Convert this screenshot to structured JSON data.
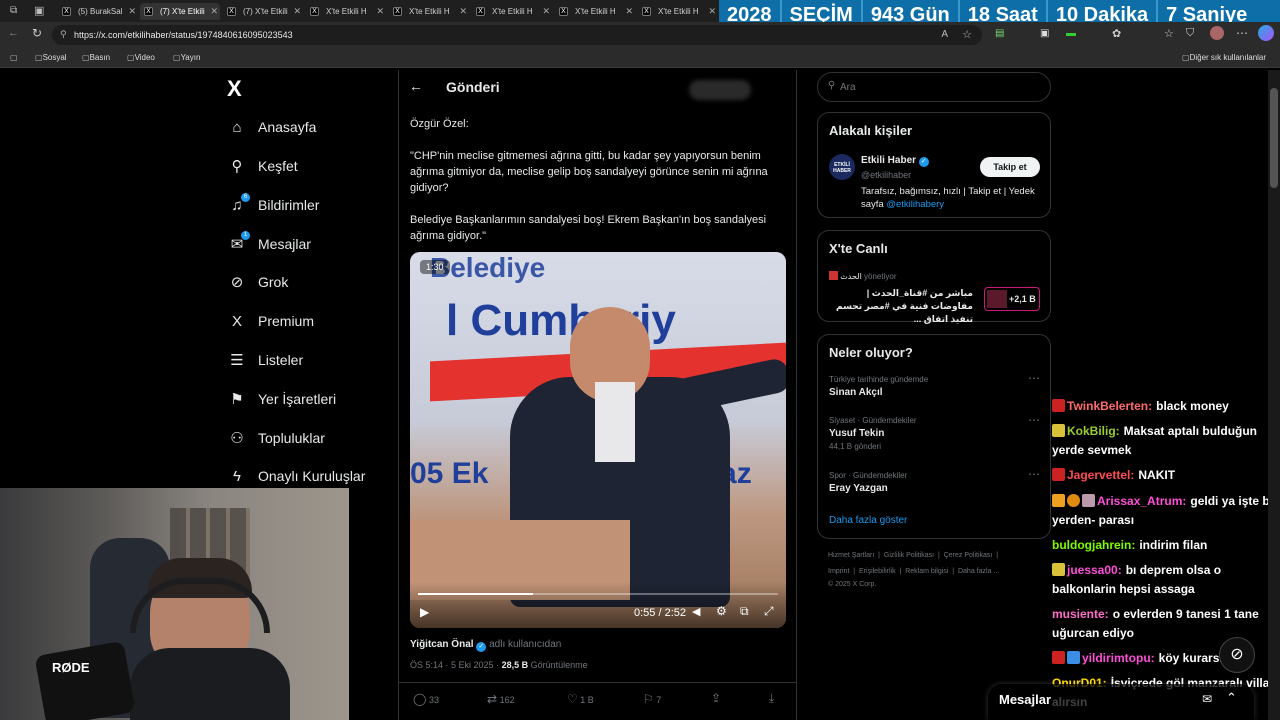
{
  "browser": {
    "tabs": [
      {
        "label": "(5) BurakSal"
      },
      {
        "label": "(7) X'te Etkili"
      },
      {
        "label": "(7) X'te Etkili"
      },
      {
        "label": "X'te Etkili H"
      },
      {
        "label": "X'te Etkili H"
      },
      {
        "label": "X'te Etkili H"
      },
      {
        "label": "X'te Etkili H"
      },
      {
        "label": "X'te Etkili H"
      }
    ],
    "url": "https://x.com/etkilihaber/status/1974840616095023543",
    "bookmarks": [
      "Sosyal",
      "Basın",
      "Video",
      "Yayın"
    ],
    "bookmarks_right": "Diğer sık kullanılanlar"
  },
  "countdown": {
    "year": "2028",
    "label": "SEÇİM",
    "days": "943 Gün",
    "hours": "18 Saat",
    "minutes": "10 Dakika",
    "seconds": "7 Saniye"
  },
  "nav": {
    "logo": "X",
    "items": [
      {
        "label": "Anasayfa",
        "icon": "home-icon"
      },
      {
        "label": "Keşfet",
        "icon": "search-icon"
      },
      {
        "label": "Bildirimler",
        "icon": "bell-icon",
        "badge": "6"
      },
      {
        "label": "Mesajlar",
        "icon": "mail-icon",
        "badge": "1"
      },
      {
        "label": "Grok",
        "icon": "grok-icon"
      },
      {
        "label": "Premium",
        "icon": "x-icon"
      },
      {
        "label": "Listeler",
        "icon": "list-icon"
      },
      {
        "label": "Yer İşaretleri",
        "icon": "bookmark-icon"
      },
      {
        "label": "Topluluklar",
        "icon": "people-icon"
      },
      {
        "label": "Onaylı Kuruluşlar",
        "icon": "lightning-icon"
      }
    ]
  },
  "post": {
    "header": "Gönderi",
    "speaker": "Özgür Özel:",
    "quote1": "\"CHP'nin meclise gitmemesi ağrına gitti, bu kadar şey yapıyorsun benim ağrıma gitmiyor da, meclise gelip boş sandalyeyi görünce senin mi ağrına gidiyor?",
    "quote2": "Belediye Başkanlarımın sandalyesi boş! Ekrem Başkan'ın boş sandalyesi ağrıma gidiyor.\"",
    "video": {
      "duration_badge": "1:30",
      "time": "0:55 / 2:52",
      "progress": 0.32,
      "banner_top": "Belediye",
      "banner_mid": "l Cumhuriy",
      "banner_bottom_left": "05 Ek",
      "banner_bottom_right": "5 Paz"
    },
    "author_name": "Yiğitcan Önal",
    "author_handle": "adlı kullanıcıdan",
    "timestamp": "ÖS 5:14 · 5 Eki 2025",
    "views_count": "28,5 B",
    "views_label": "Görüntülenme",
    "actions": {
      "replies": "33",
      "reposts": "162",
      "likes": "1 B",
      "bookmarks": "7"
    }
  },
  "sidebar": {
    "search_placeholder": "Ara",
    "related_title": "Alakalı kişiler",
    "related_person": {
      "name": "Etkili Haber",
      "handle": "@etkilihaber",
      "follow_label": "Takip et",
      "bio": "Tarafsız, bağımsız, hızlı | Takip et | Yedek sayfa",
      "bio_link": "@etkilihabery",
      "avatar_text": "ETKİLİ HABER"
    },
    "live_title": "X'te Canlı",
    "live": {
      "channel": "الحدث",
      "status": "yönetiyor",
      "text": "مباشر من #قناة_الحدث | مفاوضات فنية في #مصر تحسم تنفيذ اتفاق ...",
      "count": "+2,1 B"
    },
    "trends_title": "Neler oluyor?",
    "trends": [
      {
        "context": "Türkiye tarihinde gündemde",
        "name": "Sinan Akçıl",
        "posts": ""
      },
      {
        "context": "Siyaset · Gündemdekiler",
        "name": "Yusuf Tekin",
        "posts": "44,1 B gönderi"
      },
      {
        "context": "Spor · Gündemdekiler",
        "name": "Eray Yazgan",
        "posts": ""
      }
    ],
    "show_more": "Daha fazla göster",
    "footer_line1": [
      "Hizmet Şartları",
      "Gizlilik Politikası",
      "Çerez Politikası"
    ],
    "footer_line2": [
      "Imprint",
      "Erişilebilirlik",
      "Reklam bilgisi",
      "Daha fazla ..."
    ],
    "copyright": "© 2025 X Corp."
  },
  "chat": [
    {
      "user": "TwinkBelerten:",
      "msg": "black money",
      "color": "#ff6b6b"
    },
    {
      "user": "KokBilig:",
      "msg": "Maksat aptalı bulduğun yerde sevmek",
      "color": "#9acd32"
    },
    {
      "user": "Jagervettel:",
      "msg": "NAKIT",
      "color": "#ff4d4d"
    },
    {
      "user": "Arissax_Atrum:",
      "msg": "geldi ya işte bi yerden- parası",
      "color": "#ff4fd8"
    },
    {
      "user": "buldogjahrein:",
      "msg": "indirim filan",
      "color": "#7cfc00"
    },
    {
      "user": "juessa00:",
      "msg": "bı deprem olsa o balkonlarin hepsi assaga",
      "color": "#ff4fd8"
    },
    {
      "user": "musiente:",
      "msg": "o evlerden 9 tanesi 1 tane uğurcan ediyo",
      "color": "#ff6ec7"
    },
    {
      "user": "yildirimtopu:",
      "msg": "köy kurarsın",
      "color": "#ff4fd8"
    },
    {
      "user": "OnurD01:",
      "msg": "İsviçrede göl manzaralı villa alırsın",
      "color": "#ffd700"
    }
  ],
  "messages_bar": {
    "label": "Mesajlar"
  },
  "webcam": {
    "mic_brand": "RØDE"
  }
}
